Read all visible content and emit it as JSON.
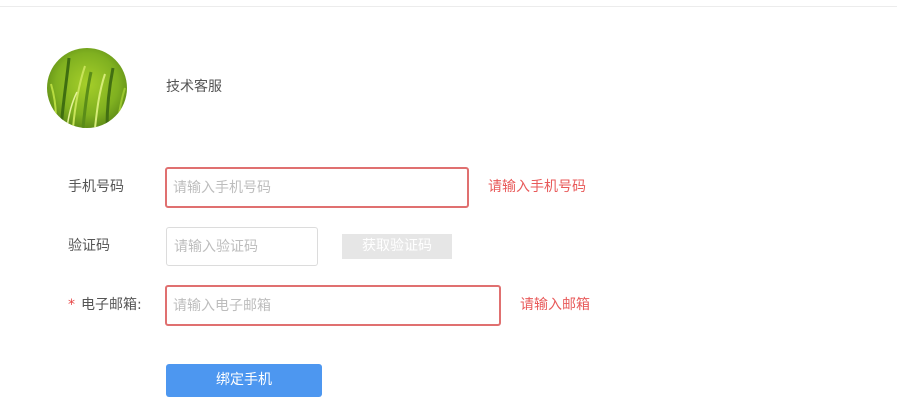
{
  "user": {
    "name": "技术客服",
    "avatar_icon": "grass-photo-avatar"
  },
  "form": {
    "phone": {
      "label": "手机号码",
      "placeholder": "请输入手机号码",
      "value": "",
      "error": "请输入手机号码"
    },
    "code": {
      "label": "验证码",
      "placeholder": "请输入验证码",
      "value": "",
      "button_label": "获取验证码"
    },
    "email": {
      "required_mark": "*",
      "label": "电子邮箱:",
      "placeholder": "请输入电子邮箱",
      "value": "",
      "error": "请输入邮箱"
    },
    "submit_label": "绑定手机"
  },
  "colors": {
    "error": "#e85a5a",
    "primary_button": "#4d97f0",
    "disabled_button": "#e6e6e6"
  }
}
